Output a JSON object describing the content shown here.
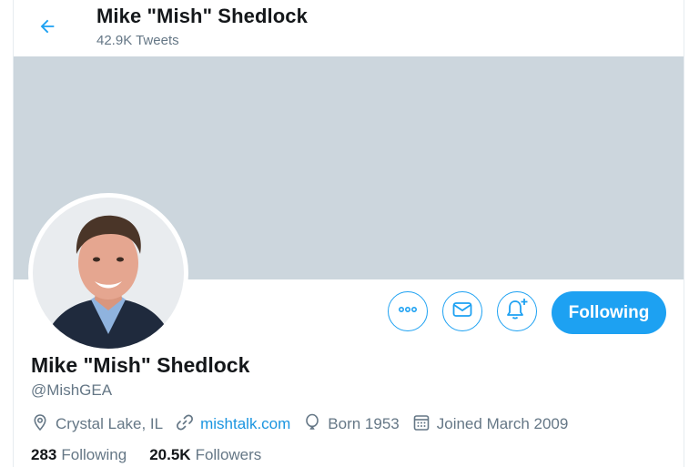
{
  "header": {
    "title": "Mike \"Mish\" Shedlock",
    "tweet_count": "42.9K Tweets",
    "back_icon": "arrow-left-icon"
  },
  "profile": {
    "name": "Mike \"Mish\" Shedlock",
    "handle": "@MishGEA",
    "location": "Crystal Lake, IL",
    "website": "mishtalk.com",
    "born": "Born 1953",
    "joined": "Joined March 2009"
  },
  "actions": {
    "more_icon": "more-icon",
    "message_icon": "envelope-icon",
    "notify_icon": "bell-plus-icon",
    "follow_label": "Following"
  },
  "stats": {
    "following_count": "283",
    "following_label": "Following",
    "followers_count": "20.5K",
    "followers_label": "Followers"
  },
  "colors": {
    "accent": "#1da1f2",
    "banner": "#ccd6dd",
    "secondary_text": "#657786",
    "link": "#1b95e0"
  }
}
